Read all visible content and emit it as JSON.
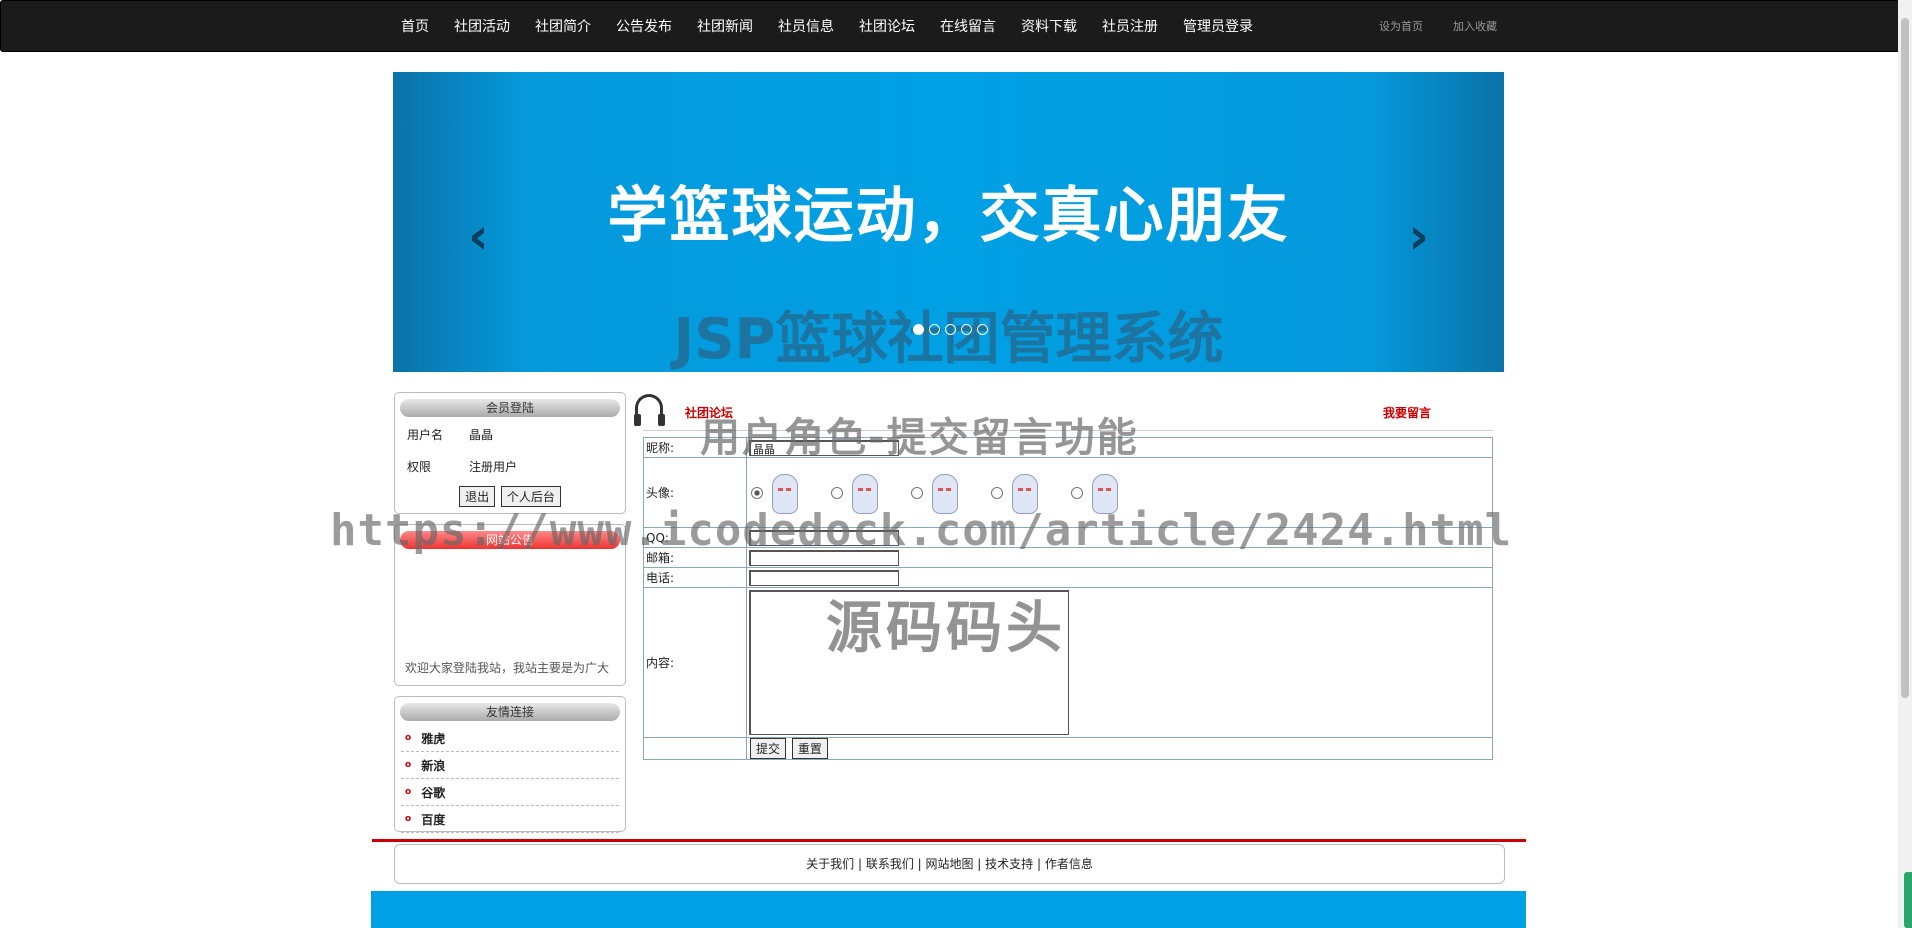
{
  "nav": {
    "items": [
      "首页",
      "社团活动",
      "社团简介",
      "公告发布",
      "社团新闻",
      "社员信息",
      "社团论坛",
      "在线留言",
      "资料下载",
      "社员注册",
      "管理员登录"
    ],
    "right_links": [
      "设为首页",
      "加入收藏"
    ]
  },
  "banner": {
    "slogan": "学篮球运动，交真心朋友",
    "prev": "‹",
    "next": "›",
    "site_title": "JSP篮球社团管理系统"
  },
  "login_box": {
    "title": "会员登陆",
    "username_label": "用户名",
    "username_value": "晶晶",
    "role_label": "权限",
    "role_value": "注册用户",
    "logout_button": "退出",
    "backend_button": "个人后台"
  },
  "notice_box": {
    "title": "网站公告",
    "text": "欢迎大家登陆我站，我站主要是为广大"
  },
  "links_box": {
    "title": "友情连接",
    "items": [
      "雅虎",
      "新浪",
      "谷歌",
      "百度"
    ]
  },
  "forum": {
    "title": "社团论坛",
    "leave_message": "我要留言"
  },
  "form": {
    "nickname_label": "昵称:",
    "nickname_value": "晶晶",
    "avatar_label": "头像:",
    "qq_label": "QQ:",
    "email_label": "邮箱:",
    "phone_label": "电话:",
    "content_label": "内容:",
    "submit": "提交",
    "reset": "重置"
  },
  "watermarks": {
    "role_caption": "用户角色-提交留言功能",
    "url": "https://www.icodedock.com/article/2424.html",
    "brand": "源码码头"
  },
  "footer": {
    "links": "关于我们 | 联系我们 | 网站地图 | 技术支持 | 作者信息"
  }
}
